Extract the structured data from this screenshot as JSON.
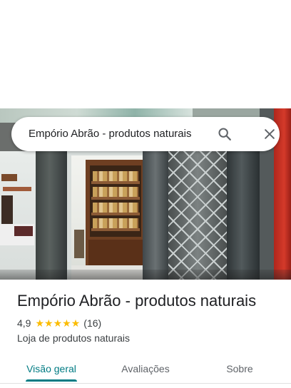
{
  "search": {
    "query": "Empório Abrão - produtos naturais"
  },
  "place": {
    "title": "Empório Abrão - produtos naturais",
    "rating": "4,9",
    "stars": 5,
    "review_count": "(16)",
    "category": "Loja de produtos naturais"
  },
  "tabs": [
    {
      "label": "Visão geral",
      "active": true
    },
    {
      "label": "Avaliações",
      "active": false
    },
    {
      "label": "Sobre",
      "active": false
    }
  ],
  "colors": {
    "accent": "#007b83",
    "star": "#fbbc04"
  },
  "icons": {
    "search": "search-icon",
    "close": "close-icon",
    "star": "star-icon"
  }
}
